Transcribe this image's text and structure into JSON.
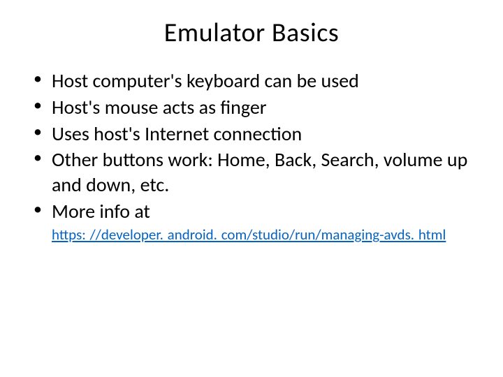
{
  "title": "Emulator Basics",
  "bullets": [
    "Host computer's keyboard can be used",
    "Host's mouse acts as finger",
    "Uses host's Internet connection",
    "Other buttons work: Home, Back, Search, volume up and down, etc.",
    "More info at"
  ],
  "link_text": "https: //developer. android. com/studio/run/managing-avds. html"
}
